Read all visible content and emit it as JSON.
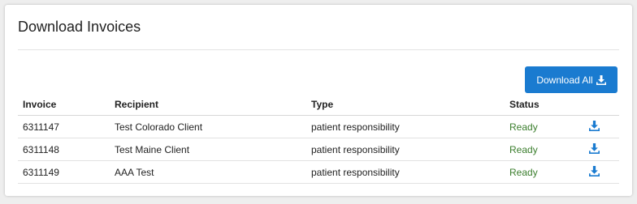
{
  "panel": {
    "title": "Download Invoices"
  },
  "download_all": {
    "label": "Download All",
    "icon": "download-icon"
  },
  "table": {
    "headers": [
      "Invoice",
      "Recipient",
      "Type",
      "Status"
    ],
    "rows": [
      {
        "invoice": "6311147",
        "recipient": "Test Colorado Client",
        "type": "patient responsibility",
        "status": "Ready"
      },
      {
        "invoice": "6311148",
        "recipient": "Test Maine Client",
        "type": "patient responsibility",
        "status": "Ready"
      },
      {
        "invoice": "6311149",
        "recipient": "AAA Test",
        "type": "patient responsibility",
        "status": "Ready"
      }
    ]
  },
  "colors": {
    "accent": "#1a7bd0",
    "status_ready": "#3a7d2c"
  }
}
